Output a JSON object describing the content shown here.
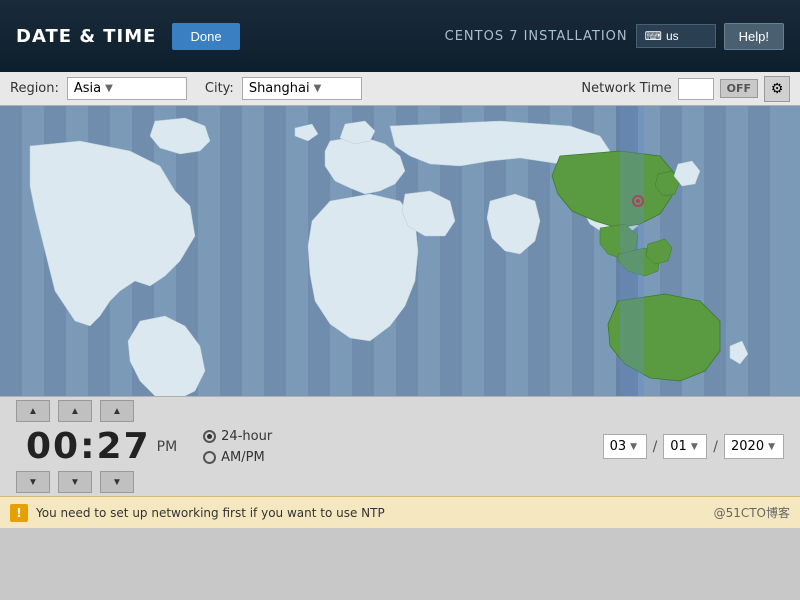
{
  "header": {
    "title": "DATE & TIME",
    "done_label": "Done",
    "centos_label": "CENTOS 7 INSTALLATION",
    "search_value": "us",
    "help_label": "Help!",
    "keyboard_icon": "⌨"
  },
  "toolbar": {
    "region_label": "Region:",
    "region_value": "Asia",
    "city_label": "City:",
    "city_value": "Shanghai",
    "ntp_label": "Network Time",
    "ntp_toggle": "OFF",
    "gear_icon": "⚙"
  },
  "time": {
    "hours": "00",
    "minutes": "27",
    "ampm": "PM",
    "format_24": "24-hour",
    "format_ampm": "AM/PM",
    "up_arrow": "▲",
    "down_arrow": "▼"
  },
  "date": {
    "month": "03",
    "day": "01",
    "year": "2020",
    "slash": "/"
  },
  "status": {
    "warning_icon": "!",
    "message": "You need to set up networking first if you want to use NTP",
    "brand": "@51CTO博客"
  }
}
